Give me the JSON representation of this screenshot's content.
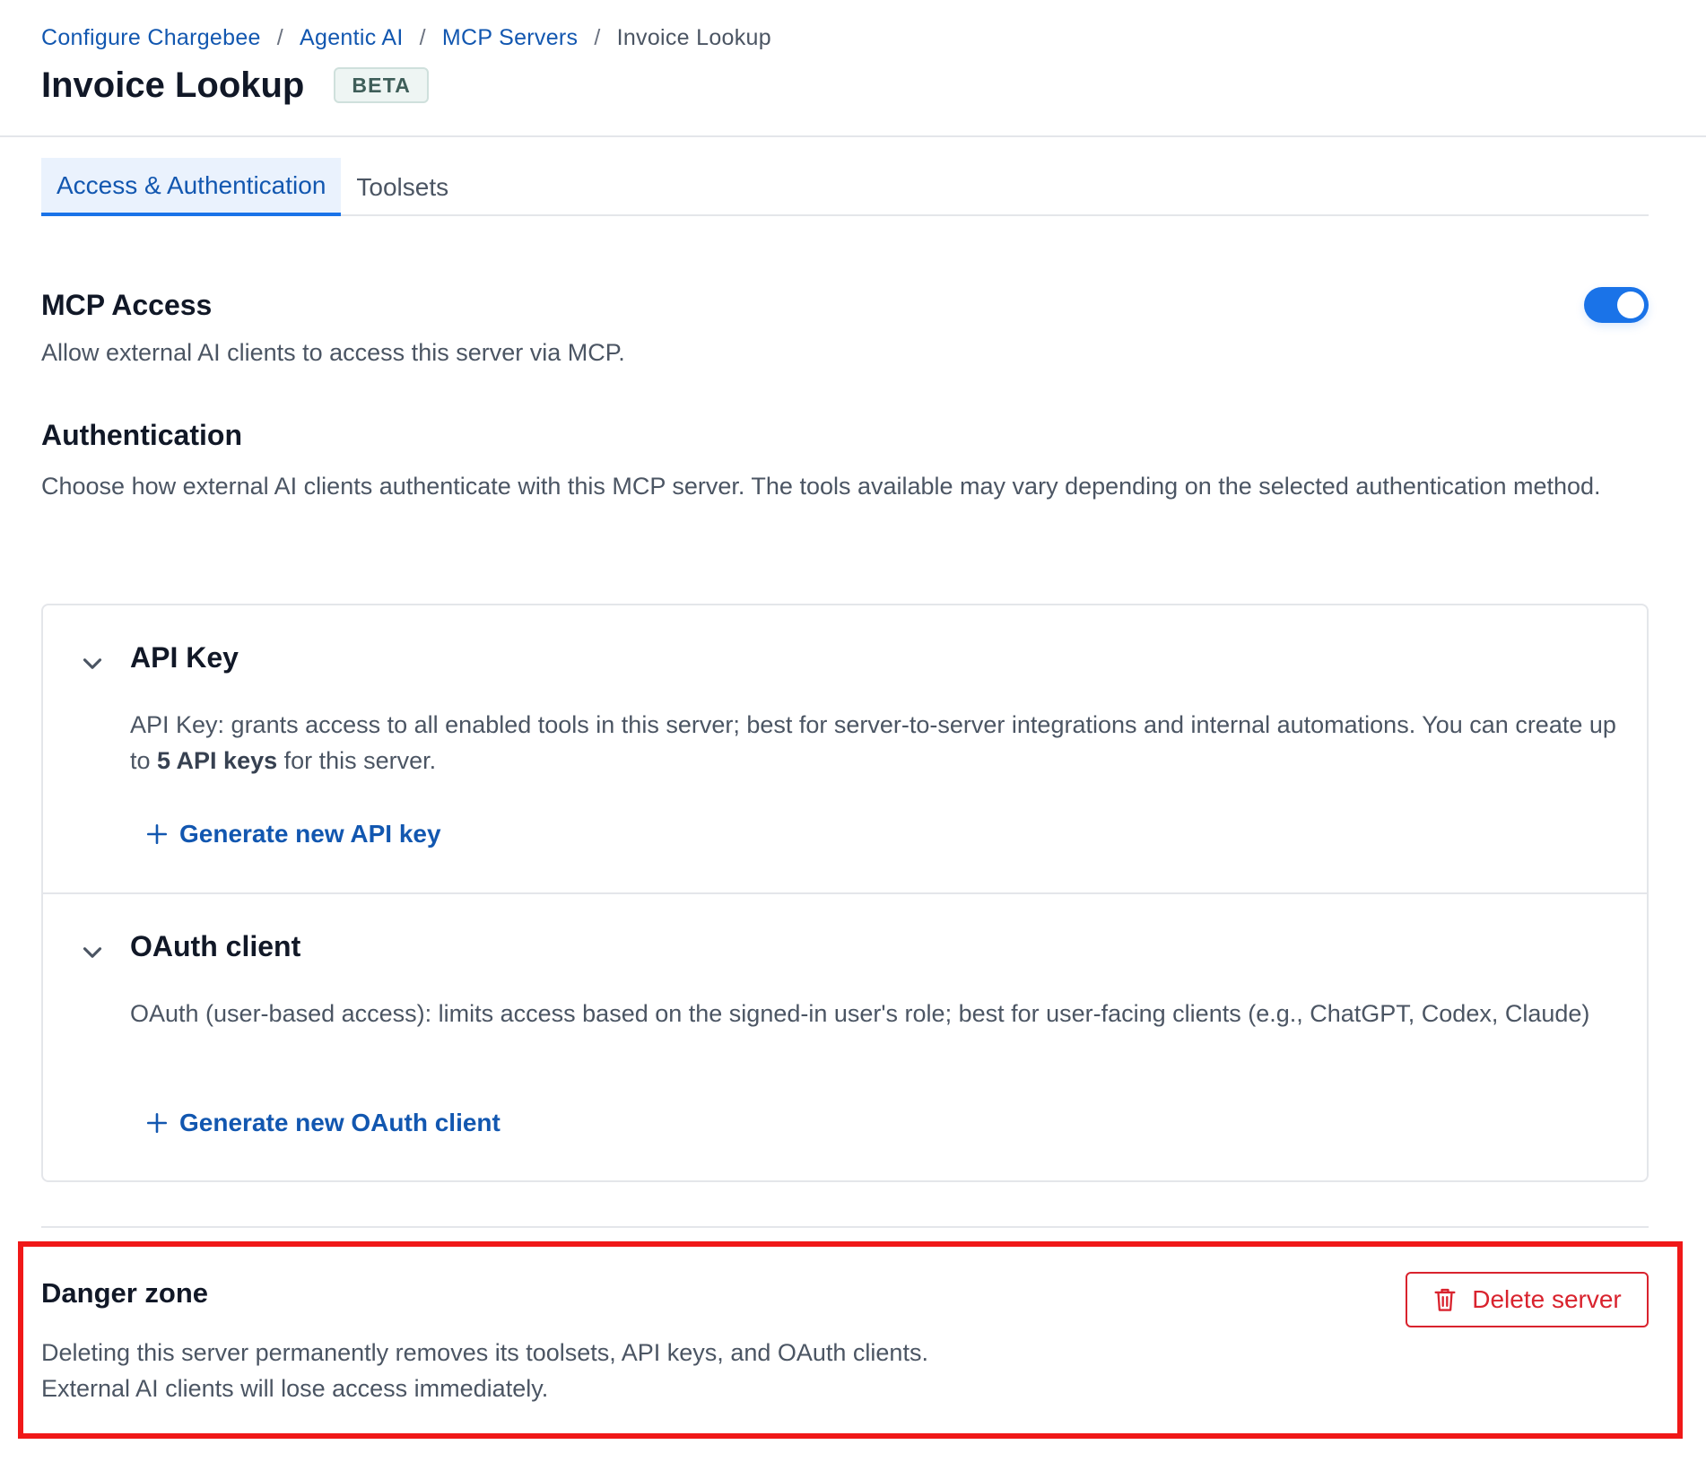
{
  "breadcrumb": {
    "items": [
      "Configure Chargebee",
      "Agentic AI",
      "MCP Servers"
    ],
    "current": "Invoice Lookup",
    "separator": "/"
  },
  "header": {
    "title": "Invoice Lookup",
    "badge": "BETA"
  },
  "tabs": [
    {
      "label": "Access & Authentication",
      "active": true
    },
    {
      "label": "Toolsets",
      "active": false
    }
  ],
  "mcp_access": {
    "title": "MCP Access",
    "description": "Allow external AI clients to access this server via MCP.",
    "enabled": true
  },
  "authentication": {
    "title": "Authentication",
    "description": "Choose how external AI clients authenticate with this MCP server. The tools available may vary depending on the selected authentication method.",
    "methods": [
      {
        "title": "API Key",
        "desc_prefix": "API Key: grants access to all enabled tools in this server; best for server-to-server integrations and internal automations. You can create up to ",
        "desc_bold": "5 API keys",
        "desc_suffix": " for this server.",
        "action": "Generate new API key",
        "expanded": true
      },
      {
        "title": "OAuth client",
        "description": "OAuth (user-based access): limits access based on the signed-in user's role; best for user-facing clients (e.g., ChatGPT, Codex, Claude)",
        "action": "Generate new OAuth client",
        "expanded": true
      }
    ]
  },
  "danger_zone": {
    "title": "Danger zone",
    "line1": "Deleting this server permanently removes its toolsets, API keys, and OAuth clients.",
    "line2": "External AI clients will lose access immediately.",
    "button": "Delete server"
  },
  "colors": {
    "link": "#1257b0",
    "accent": "#1a73e8",
    "danger": "#d9232e",
    "highlight": "#f01818"
  }
}
